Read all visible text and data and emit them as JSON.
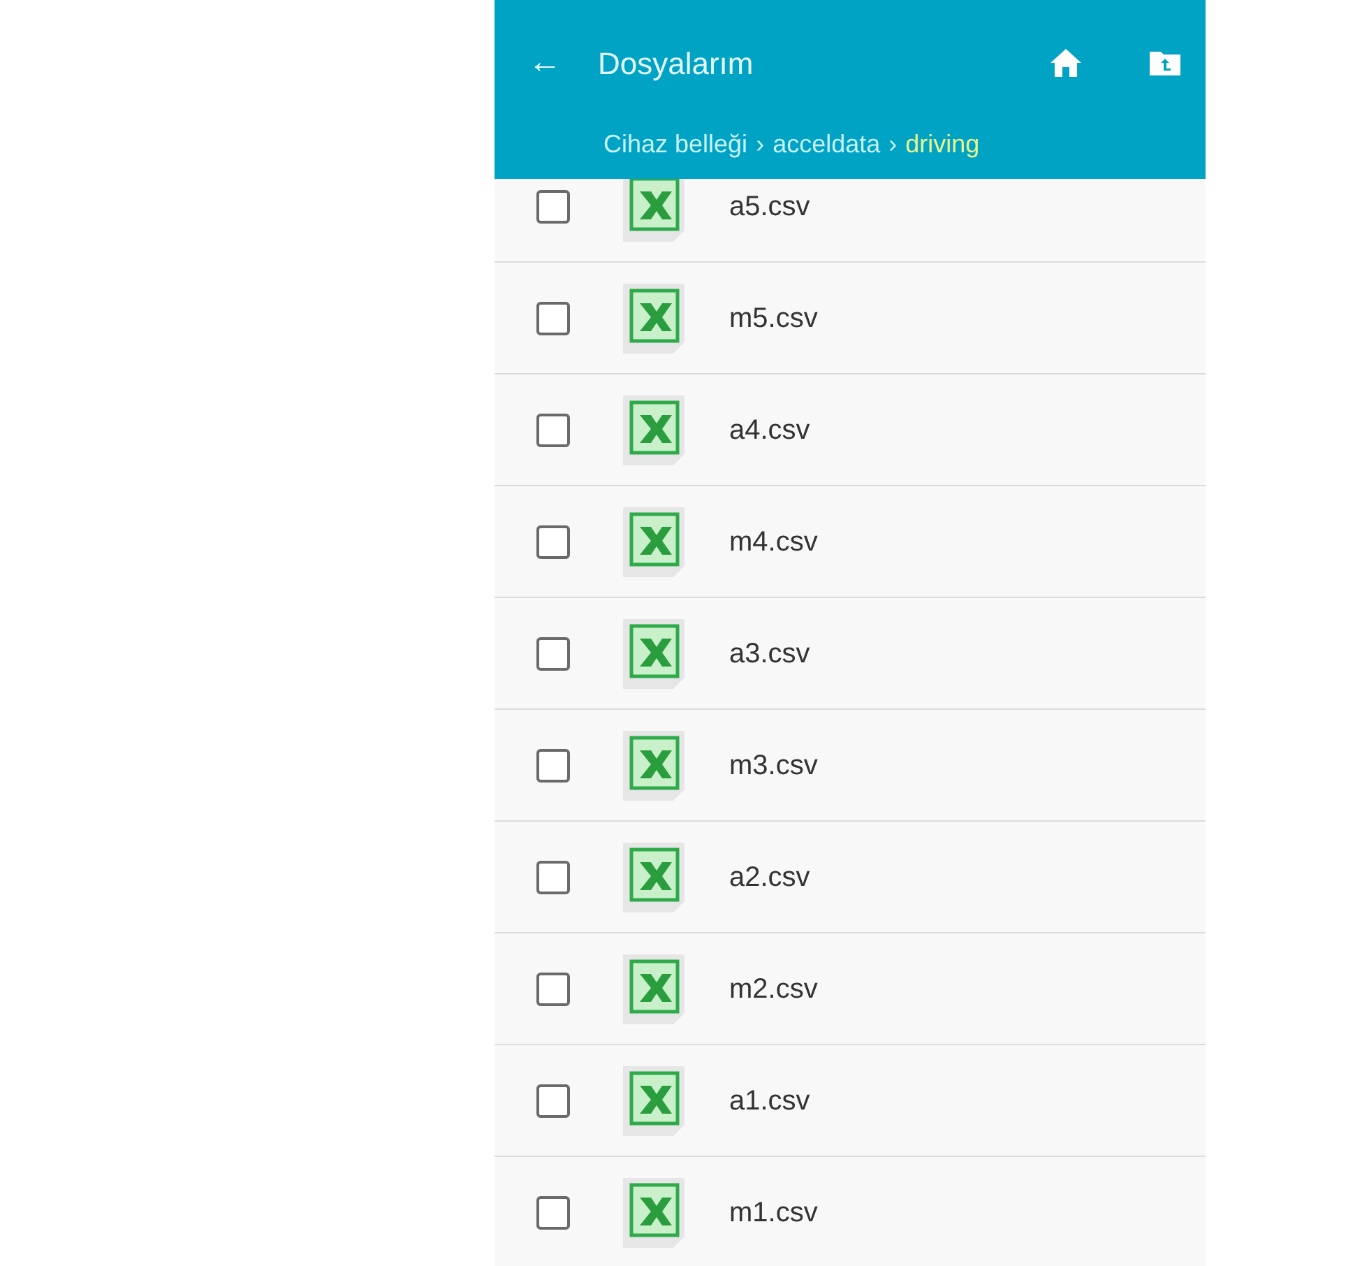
{
  "header": {
    "back": "←",
    "title": "Dosyalarım"
  },
  "breadcrumb": [
    {
      "label": "Cihaz belleği",
      "selected": false
    },
    {
      "separator": "›"
    },
    {
      "label": "acceldata",
      "selected": false
    },
    {
      "separator": "›"
    },
    {
      "label": "driving",
      "selected": true
    }
  ],
  "files": [
    {
      "name": "a5.csv",
      "checked": false
    },
    {
      "name": "m5.csv",
      "checked": false
    },
    {
      "name": "a4.csv",
      "checked": false
    },
    {
      "name": "m4.csv",
      "checked": false
    },
    {
      "name": "a3.csv",
      "checked": false
    },
    {
      "name": "m3.csv",
      "checked": false
    },
    {
      "name": "a2.csv",
      "checked": false
    },
    {
      "name": "m2.csv",
      "checked": false
    },
    {
      "name": "a1.csv",
      "checked": false
    },
    {
      "name": "m1.csv",
      "checked": false
    }
  ]
}
